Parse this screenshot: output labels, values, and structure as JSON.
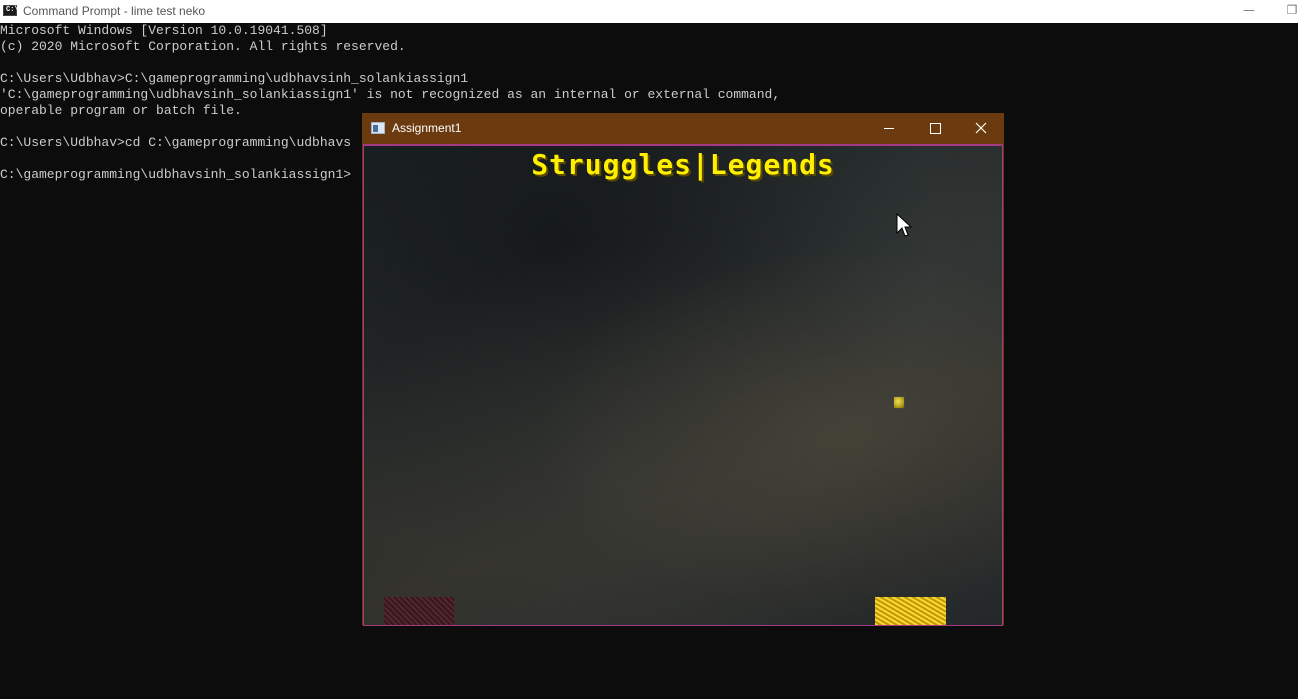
{
  "cmd_window": {
    "title": "Command Prompt - lime  test neko",
    "icon_text": "C:\\",
    "controls": {
      "minimize": "—",
      "restore": "❐"
    }
  },
  "console": {
    "lines": [
      "Microsoft Windows [Version 10.0.19041.508]",
      "(c) 2020 Microsoft Corporation. All rights reserved.",
      "",
      "C:\\Users\\Udbhav>C:\\gameprogramming\\udbhavsinh_solankiassign1",
      "'C:\\gameprogramming\\udbhavsinh_solankiassign1' is not recognized as an internal or external command,",
      "operable program or batch file.",
      "",
      "C:\\Users\\Udbhav>cd C:\\gameprogramming\\udbhavs",
      "",
      "C:\\gameprogramming\\udbhavsinh_solankiassign1>"
    ]
  },
  "game_window": {
    "title": "Assignment1",
    "banner": "Struggles|Legends",
    "colors": {
      "titlebar": "#6b3a0f",
      "canvas_border": "#a43a86",
      "banner_text": "#ffef00"
    },
    "icons": [
      "app-icon",
      "minimize-icon",
      "maximize-icon",
      "close-icon"
    ]
  }
}
